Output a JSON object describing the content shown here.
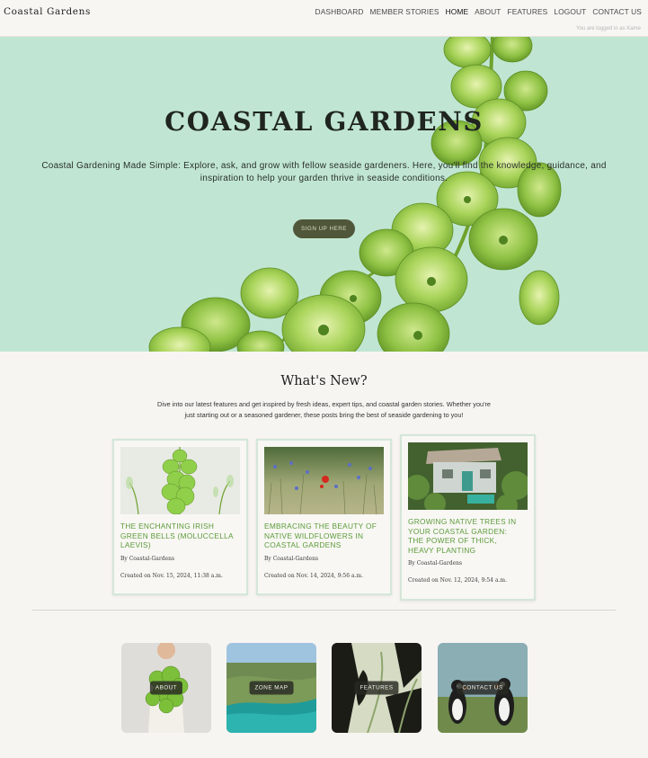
{
  "nav": {
    "brand": "Coastal Gardens",
    "links": [
      {
        "label": "DASHBOARD"
      },
      {
        "label": "MEMBER STORIES"
      },
      {
        "label": "HOME"
      },
      {
        "label": "ABOUT"
      },
      {
        "label": "FEATURES"
      },
      {
        "label": "LOGOUT"
      },
      {
        "label": "CONTACT US"
      }
    ],
    "active": "HOME",
    "logged_in": "You are logged in as Kame"
  },
  "hero": {
    "title": "COASTAL GARDENS",
    "text": "Coastal Gardening Made Simple: Explore, ask, and grow with fellow seaside gardeners. Here, you'll find the knowledge, guidance, and inspiration to help your garden thrive in seaside conditions.",
    "button": "SIGN UP HERE"
  },
  "whats_new": {
    "title": "What's New?",
    "intro": "Dive into our latest features and get inspired by fresh ideas, expert tips, and coastal garden stories. Whether you're just starting out or a seasoned gardener, these posts bring the best of seaside gardening to you!",
    "posts": [
      {
        "title": "THE ENCHANTING IRISH GREEN BELLS (MOLUCCELLA LAEVIS)",
        "author": "By Coastal-Gardens",
        "created": "Created on Nov. 15, 2024, 11:38 a.m.",
        "image": "green-bells-photo"
      },
      {
        "title": "EMBRACING THE BEAUTY OF NATIVE WILDFLOWERS IN COASTAL GARDENS",
        "author": "By Coastal-Gardens",
        "created": "Created on Nov. 14, 2024, 9:56 a.m.",
        "image": "wildflower-meadow-photo"
      },
      {
        "title": "GROWING NATIVE TREES IN YOUR COASTAL GARDEN: THE POWER OF THICK, HEAVY PLANTING",
        "author": "By Coastal-Gardens",
        "created": "Created on Nov. 12, 2024, 9:54 a.m.",
        "image": "cottage-garden-photo"
      }
    ]
  },
  "tiles": [
    {
      "label": "ABOUT",
      "image": "woman-holding-bells-photo"
    },
    {
      "label": "ZONE MAP",
      "image": "coastline-photo"
    },
    {
      "label": "FEATURES",
      "image": "botanical-print-illustration"
    },
    {
      "label": "CONTACT US",
      "image": "puffins-photo"
    }
  ],
  "colors": {
    "hero_bg": "#c0e6d3",
    "button_bg": "#4f5639",
    "card_title": "#5c9b3b",
    "page_bg": "#f7f5f1"
  }
}
